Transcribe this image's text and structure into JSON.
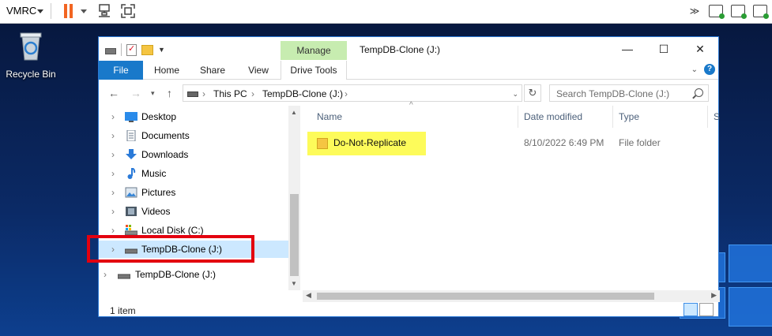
{
  "vmrc": {
    "title": "VMRC"
  },
  "desktop": {
    "recycle_bin": "Recycle Bin"
  },
  "window": {
    "title": "TempDB-Clone (J:)",
    "manage_tab": "Manage",
    "tabs": {
      "file": "File",
      "home": "Home",
      "share": "Share",
      "view": "View",
      "drive_tools": "Drive Tools"
    }
  },
  "address": {
    "crumbs": [
      "This PC",
      "TempDB-Clone (J:)"
    ],
    "search_placeholder": "Search TempDB-Clone (J:)"
  },
  "nav": {
    "items": [
      {
        "label": "Desktop",
        "icon": "desktop-icon"
      },
      {
        "label": "Documents",
        "icon": "documents-icon"
      },
      {
        "label": "Downloads",
        "icon": "downloads-icon"
      },
      {
        "label": "Music",
        "icon": "music-icon"
      },
      {
        "label": "Pictures",
        "icon": "pictures-icon"
      },
      {
        "label": "Videos",
        "icon": "videos-icon"
      },
      {
        "label": "Local Disk (C:)",
        "icon": "local-disk-icon"
      },
      {
        "label": "TempDB-Clone (J:)",
        "icon": "drive-icon"
      },
      {
        "label": "TempDB-Clone (J:)",
        "icon": "drive-icon"
      }
    ]
  },
  "content": {
    "columns": {
      "name": "Name",
      "date": "Date modified",
      "type": "Type",
      "size": "S"
    },
    "rows": [
      {
        "name": "Do-Not-Replicate",
        "date": "8/10/2022 6:49 PM",
        "type": "File folder"
      }
    ]
  },
  "status": {
    "count": "1 item"
  },
  "colors": {
    "accent": "#1979ca",
    "selection": "#cce8ff",
    "highlight": "#fdfb5a",
    "annotation": "#e3000f"
  }
}
